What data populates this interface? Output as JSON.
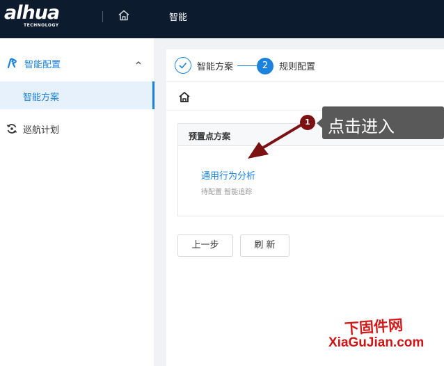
{
  "header": {
    "logo_text": "alhua",
    "logo_sub": "TECHNOLOGY",
    "home_icon": "home-icon",
    "nav_label": "智能"
  },
  "sidebar": {
    "group": {
      "label": "智能配置",
      "icon": "ai-config-icon",
      "expanded": true
    },
    "active_item": {
      "label": "智能方案"
    },
    "item": {
      "label": "巡航计划",
      "icon": "cruise-icon"
    }
  },
  "steps": [
    {
      "label": "智能方案",
      "state": "done"
    },
    {
      "number": "2",
      "label": "规则配置",
      "state": "active"
    }
  ],
  "breadcrumb": {
    "icon": "home-icon"
  },
  "card": {
    "title": "预置点方案",
    "plan_link": "通用行为分析",
    "plan_desc": "待配置 智能追踪"
  },
  "buttons": {
    "prev_label": "上一步",
    "refresh_label": "刷 新"
  },
  "annotation": {
    "marker": "1",
    "text": "点击进入"
  },
  "watermark": {
    "cn": "下固件网",
    "en": "XiaGuJian.com"
  },
  "colors": {
    "topbar": "#0c1b2e",
    "accent": "#1c82db",
    "annotation_marker": "#7b1113",
    "annotation_box": "#4b4b4b",
    "watermark": "#d41a1a"
  }
}
